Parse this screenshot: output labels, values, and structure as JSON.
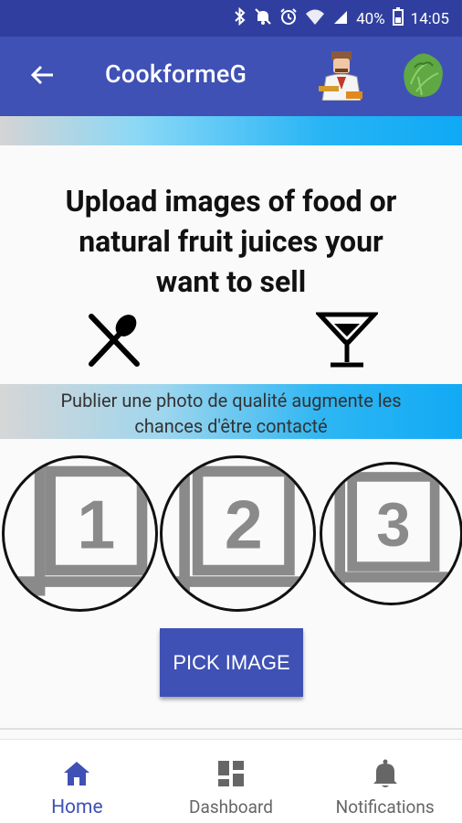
{
  "status_bar": {
    "battery": "40%",
    "time": "14:05"
  },
  "app_bar": {
    "title": "CookformeG",
    "icons": [
      "back-arrow-icon",
      "chef-icon",
      "lettuce-icon"
    ]
  },
  "headline": {
    "line1": "Upload images of food or",
    "line2": "natural fruit juices your",
    "line3": "want to sell"
  },
  "tip": {
    "line1": "Publier une photo de qualité augmente les",
    "line2": "chances d'être contacté"
  },
  "slots": [
    {
      "number": "1"
    },
    {
      "number": "2"
    },
    {
      "number": "3"
    }
  ],
  "pick_button": {
    "label": "PICK IMAGE"
  },
  "bottom_nav": {
    "items": [
      {
        "label": "Home",
        "icon": "home-icon",
        "active": true
      },
      {
        "label": "Dashboard",
        "icon": "dashboard-icon",
        "active": false
      },
      {
        "label": "Notifications",
        "icon": "bell-icon",
        "active": false
      }
    ]
  },
  "colors": {
    "primary": "#3f51b5",
    "primary_dark": "#303f9f",
    "accent_gradient_end": "#0fa9f5"
  }
}
